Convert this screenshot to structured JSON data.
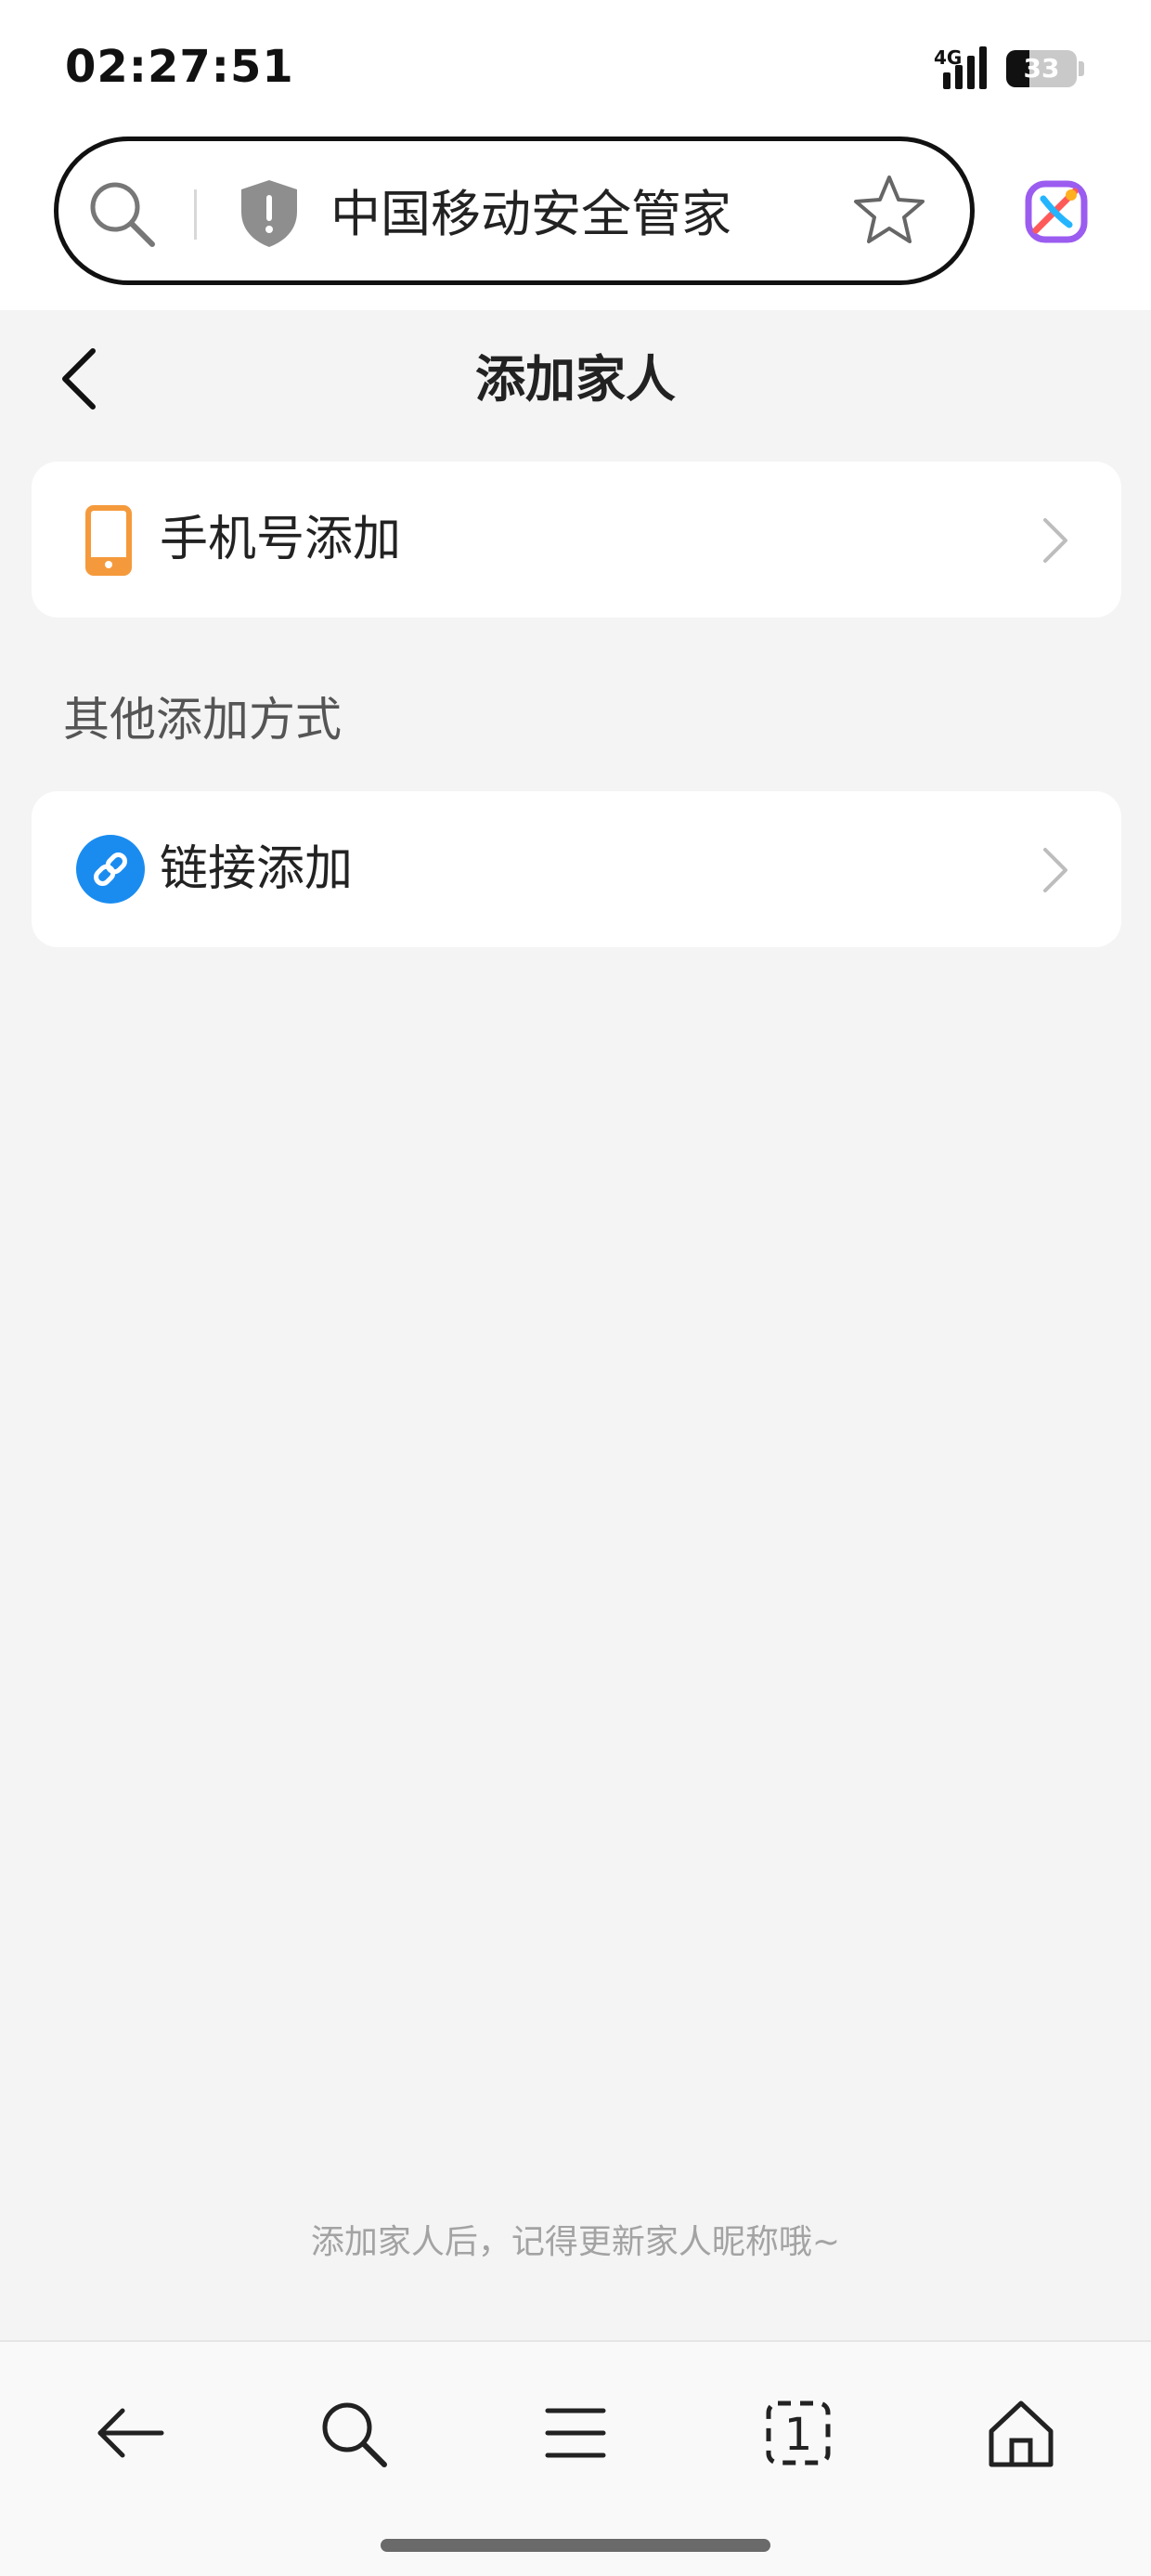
{
  "status_bar": {
    "time": "02:27:51",
    "network": "4G",
    "battery_percent": 33,
    "battery_text": "33"
  },
  "browser": {
    "address_text": "中国移动安全管家",
    "icons": [
      "search-icon",
      "shield-icon",
      "star-icon",
      "app-logo-icon"
    ]
  },
  "header": {
    "title": "添加家人"
  },
  "main": {
    "primary_option": {
      "label": "手机号添加",
      "icon": "phone-icon"
    },
    "section_title": "其他添加方式",
    "other_options": [
      {
        "label": "链接添加",
        "icon": "link-icon"
      }
    ],
    "footer_hint": "添加家人后，记得更新家人昵称哦~"
  },
  "bottom_nav": {
    "items": [
      "back-icon",
      "search-icon",
      "menu-icon",
      "tabs-icon",
      "home-icon"
    ],
    "tab_count": "1"
  },
  "colors": {
    "background": "#f4f4f4",
    "card": "#ffffff",
    "phone_icon": "#f59a3c",
    "link_icon": "#1a8cf0",
    "hint_text": "#a3a3a3"
  }
}
